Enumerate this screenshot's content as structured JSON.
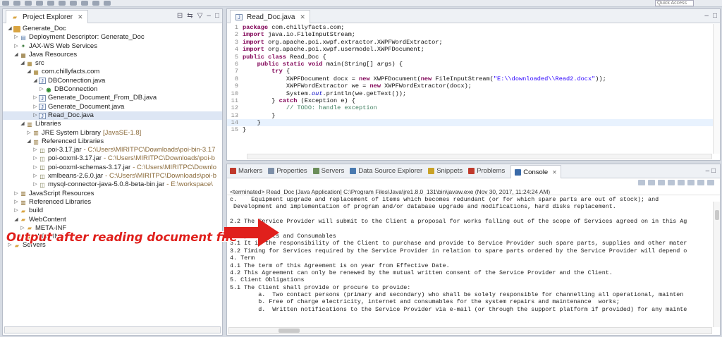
{
  "toolbar": {
    "quick_access_placeholder": "Quick Access"
  },
  "project_explorer": {
    "title": "Project Explorer",
    "tree": [
      {
        "label": "Generate_Doc",
        "icon": "project-icon",
        "depth": 0,
        "expanded": true
      },
      {
        "label": "Deployment Descriptor: Generate_Doc",
        "icon": "deployment-descriptor-icon",
        "depth": 1
      },
      {
        "label": "JAX-WS Web Services",
        "icon": "web-services-icon",
        "depth": 1
      },
      {
        "label": "Java Resources",
        "icon": "java-resources-icon",
        "depth": 1,
        "expanded": true
      },
      {
        "label": "src",
        "icon": "source-folder-icon",
        "depth": 2,
        "expanded": true
      },
      {
        "label": "com.chillyfacts.com",
        "icon": "package-icon",
        "depth": 3,
        "expanded": true
      },
      {
        "label": "DBConnection.java",
        "icon": "java-file-icon",
        "depth": 4,
        "expanded": true
      },
      {
        "label": "DBConnection",
        "icon": "class-icon",
        "depth": 5
      },
      {
        "label": "Generate_Document_From_DB.java",
        "icon": "java-file-icon",
        "depth": 4
      },
      {
        "label": "Generate_Document.java",
        "icon": "java-file-icon",
        "depth": 4
      },
      {
        "label": "Read_Doc.java",
        "icon": "java-file-icon",
        "depth": 4,
        "selected": true
      },
      {
        "label": "Libraries",
        "icon": "library-icon",
        "depth": 2,
        "expanded": true
      },
      {
        "label": "JRE System Library",
        "suffix": "[JavaSE-1.8]",
        "icon": "jre-library-icon",
        "depth": 3
      },
      {
        "label": "Referenced Libraries",
        "icon": "library-icon",
        "depth": 3,
        "expanded": true
      },
      {
        "label": "poi-3.17.jar",
        "suffix": "- C:\\Users\\MIRITPC\\Downloads\\poi-bin-3.17",
        "icon": "jar-icon",
        "depth": 4
      },
      {
        "label": "poi-ooxml-3.17.jar",
        "suffix": "- C:\\Users\\MIRITPC\\Downloads\\poi-b",
        "icon": "jar-icon",
        "depth": 4
      },
      {
        "label": "poi-ooxml-schemas-3.17.jar",
        "suffix": "- C:\\Users\\MIRITPC\\Downlo",
        "icon": "jar-icon",
        "depth": 4
      },
      {
        "label": "xmlbeans-2.6.0.jar",
        "suffix": "- C:\\Users\\MIRITPC\\Downloads\\poi-b",
        "icon": "jar-icon",
        "depth": 4
      },
      {
        "label": "mysql-connector-java-5.0.8-beta-bin.jar",
        "suffix": "- E:\\workspace\\",
        "icon": "jar-icon",
        "depth": 4
      },
      {
        "label": "JavaScript Resources",
        "icon": "library-icon",
        "depth": 1
      },
      {
        "label": "Referenced Libraries",
        "icon": "library-icon",
        "depth": 1
      },
      {
        "label": "build",
        "icon": "folder-icon",
        "depth": 1
      },
      {
        "label": "WebContent",
        "icon": "folder-icon",
        "depth": 1,
        "expanded": true
      },
      {
        "label": "META-INF",
        "icon": "folder-icon",
        "depth": 2
      },
      {
        "label": "WEB-INF",
        "icon": "folder-icon",
        "depth": 2
      },
      {
        "label": "Servers",
        "icon": "folder-icon",
        "depth": 0
      }
    ]
  },
  "editor": {
    "tab_label": "Read_Doc.java",
    "lines": [
      "package com.chillyfacts.com;",
      "import java.io.FileInputStream;",
      "import org.apache.poi.xwpf.extractor.XWPFWordExtractor;",
      "import org.apache.poi.xwpf.usermodel.XWPFDocument;",
      "public class Read_Doc {",
      "    public static void main(String[] args) {",
      "        try {",
      "            XWPFDocument docx = new XWPFDocument(new FileInputStream(\"E:\\\\downloaded\\\\Read2.docx\"));",
      "            XWPFWordExtractor we = new XWPFWordExtractor(docx);",
      "            System.out.println(we.getText());",
      "        } catch (Exception e) {",
      "            // TODO: handle exception",
      "        }",
      "    }",
      "}"
    ],
    "line_numbers": [
      "1",
      "2",
      "3",
      "4",
      "5",
      "6",
      "7",
      "8",
      "9",
      "10",
      "11",
      "12",
      "13",
      "14",
      "15"
    ]
  },
  "console": {
    "tabs": [
      "Markers",
      "Properties",
      "Servers",
      "Data Source Explorer",
      "Snippets",
      "Problems",
      "Console"
    ],
    "active_tab": "Console",
    "terminated_text": "<terminated> Read_Doc [Java Application] C:\\Program Files\\Java\\jre1.8.0_131\\bin\\javaw.exe (Nov 30, 2017, 11:24:24 AM)",
    "output": [
      "c.    Equipment upgrade and replacement of items which becomes redundant (or for which spare parts are out of stock); and",
      " Development and implementation of program and/or database upgrade and modifications, hard disks replacement.",
      "",
      "2.2 The Service Provider will submit to the Client a proposal for works falling out of the scope of Services agreed on in this Ag",
      "",
      "3. Spare Parts and Consumables",
      "3.1 It is the responsibility of the Client to purchase and provide to Service Provider such spare parts, supplies and other mater",
      "3.2 Timing for Services required by the Service Provider in relation to spare parts ordered by the Service Provider will depend o",
      "4. Term",
      "4.1 The term of this Agreement is on year from Effective Date.",
      "4.2 This Agreement can only be renewed by the mutual written consent of the Service Provider and the Client.",
      "5. Client Obligations",
      "5.1 The Client shall provide or procure to provide:",
      "        a.  Two contact persons (primary and secondary) who shall be solely responsible for channelling all operational, mainten",
      "        b. Free of charge electricity, internet and consumables for the system repairs and maintenance  works;",
      "        d.  Written notifications to the Service Provider via e-mail (or through the support platform if provided) for any mainte"
    ]
  },
  "annotation": {
    "text": "Output after reading document file",
    "color": "#e0201c"
  }
}
